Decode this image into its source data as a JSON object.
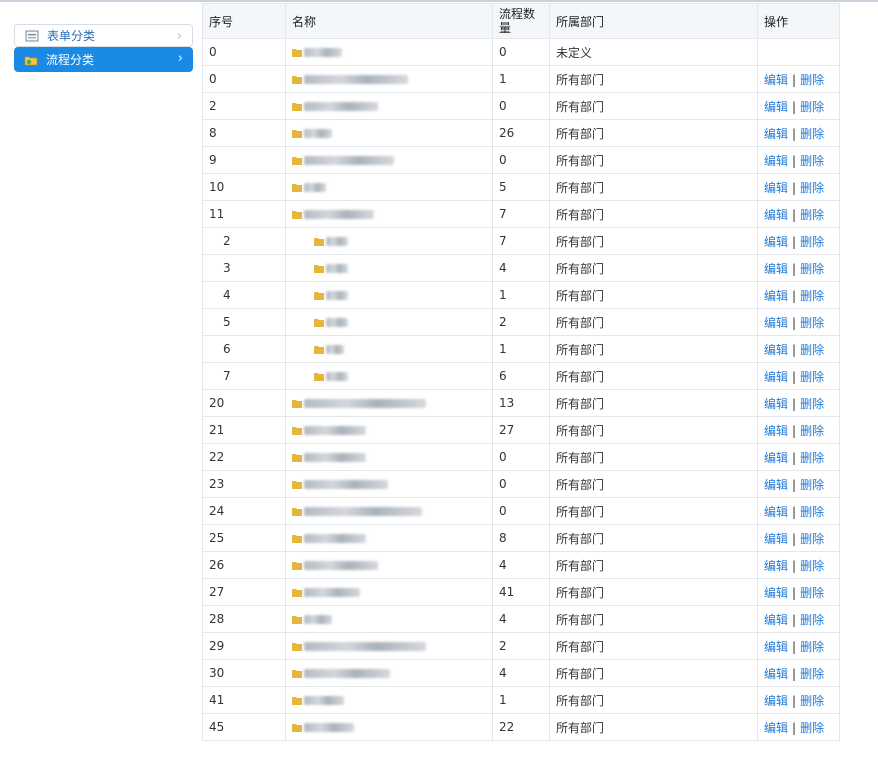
{
  "sidebar": {
    "items": [
      {
        "label": "表单分类",
        "icon": "form-icon",
        "active": false
      },
      {
        "label": "流程分类",
        "icon": "workflow-icon",
        "active": true
      }
    ]
  },
  "table": {
    "columns": [
      "序号",
      "名称",
      "流程数量",
      "所属部门",
      "操作"
    ],
    "edit_label": "编辑",
    "delete_label": "删除",
    "separator": "|",
    "rows": [
      {
        "seq": "0",
        "count": "0",
        "dept": "未定义",
        "level": 0,
        "ops": false
      },
      {
        "seq": "0",
        "count": "1",
        "dept": "所有部门",
        "level": 0,
        "ops": true
      },
      {
        "seq": "2",
        "count": "0",
        "dept": "所有部门",
        "level": 0,
        "ops": true
      },
      {
        "seq": "8",
        "count": "26",
        "dept": "所有部门",
        "level": 0,
        "ops": true
      },
      {
        "seq": "9",
        "count": "0",
        "dept": "所有部门",
        "level": 0,
        "ops": true
      },
      {
        "seq": "10",
        "count": "5",
        "dept": "所有部门",
        "level": 0,
        "ops": true
      },
      {
        "seq": "11",
        "count": "7",
        "dept": "所有部门",
        "level": 0,
        "ops": true
      },
      {
        "seq": "2",
        "count": "7",
        "dept": "所有部门",
        "level": 1,
        "ops": true
      },
      {
        "seq": "3",
        "count": "4",
        "dept": "所有部门",
        "level": 1,
        "ops": true
      },
      {
        "seq": "4",
        "count": "1",
        "dept": "所有部门",
        "level": 1,
        "ops": true
      },
      {
        "seq": "5",
        "count": "2",
        "dept": "所有部门",
        "level": 1,
        "ops": true
      },
      {
        "seq": "6",
        "count": "1",
        "dept": "所有部门",
        "level": 1,
        "ops": true
      },
      {
        "seq": "7",
        "count": "6",
        "dept": "所有部门",
        "level": 1,
        "ops": true
      },
      {
        "seq": "20",
        "count": "13",
        "dept": "所有部门",
        "level": 0,
        "ops": true
      },
      {
        "seq": "21",
        "count": "27",
        "dept": "所有部门",
        "level": 0,
        "ops": true
      },
      {
        "seq": "22",
        "count": "0",
        "dept": "所有部门",
        "level": 0,
        "ops": true
      },
      {
        "seq": "23",
        "count": "0",
        "dept": "所有部门",
        "level": 0,
        "ops": true
      },
      {
        "seq": "24",
        "count": "0",
        "dept": "所有部门",
        "level": 0,
        "ops": true
      },
      {
        "seq": "25",
        "count": "8",
        "dept": "所有部门",
        "level": 0,
        "ops": true
      },
      {
        "seq": "26",
        "count": "4",
        "dept": "所有部门",
        "level": 0,
        "ops": true
      },
      {
        "seq": "27",
        "count": "41",
        "dept": "所有部门",
        "level": 0,
        "ops": true
      },
      {
        "seq": "28",
        "count": "4",
        "dept": "所有部门",
        "level": 0,
        "ops": true
      },
      {
        "seq": "29",
        "count": "2",
        "dept": "所有部门",
        "level": 0,
        "ops": true
      },
      {
        "seq": "30",
        "count": "4",
        "dept": "所有部门",
        "level": 0,
        "ops": true
      },
      {
        "seq": "41",
        "count": "1",
        "dept": "所有部门",
        "level": 0,
        "ops": true
      },
      {
        "seq": "45",
        "count": "22",
        "dept": "所有部门",
        "level": 0,
        "ops": true
      }
    ]
  },
  "colors": {
    "accent": "#1a8ae5",
    "link": "#1f7ad8",
    "folder": "#e8b53c"
  }
}
